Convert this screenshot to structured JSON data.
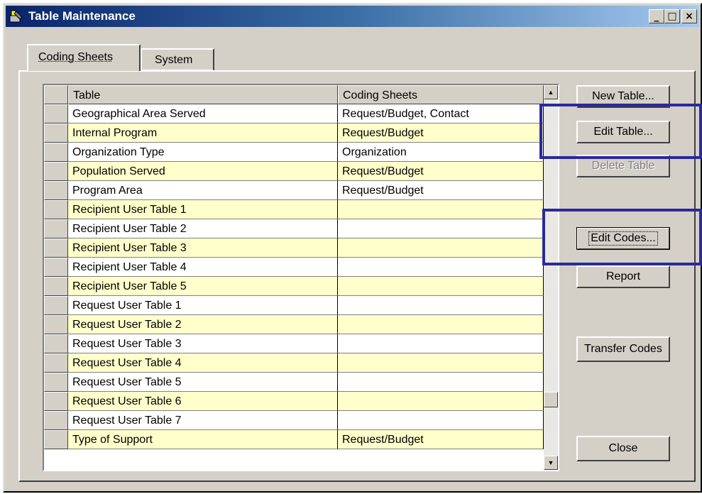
{
  "window": {
    "title": "Table Maintenance",
    "minimize_glyph": "_",
    "maximize_glyph": "□",
    "close_glyph": "×"
  },
  "tabs": [
    {
      "label": "Coding Sheets",
      "selected": true
    },
    {
      "label": "System",
      "selected": false
    }
  ],
  "grid": {
    "columns": [
      "Table",
      "Coding Sheets"
    ],
    "rows": [
      {
        "table": "Geographical Area Served",
        "sheets": "Request/Budget, Contact"
      },
      {
        "table": "Internal Program",
        "sheets": "Request/Budget"
      },
      {
        "table": "Organization Type",
        "sheets": "Organization"
      },
      {
        "table": "Population Served",
        "sheets": "Request/Budget"
      },
      {
        "table": "Program Area",
        "sheets": "Request/Budget"
      },
      {
        "table": "Recipient User Table 1",
        "sheets": ""
      },
      {
        "table": "Recipient User Table 2",
        "sheets": ""
      },
      {
        "table": "Recipient User Table 3",
        "sheets": ""
      },
      {
        "table": "Recipient User Table 4",
        "sheets": ""
      },
      {
        "table": "Recipient User Table 5",
        "sheets": ""
      },
      {
        "table": "Request User Table 1",
        "sheets": ""
      },
      {
        "table": "Request User Table 2",
        "sheets": ""
      },
      {
        "table": "Request User Table 3",
        "sheets": ""
      },
      {
        "table": "Request User Table 4",
        "sheets": ""
      },
      {
        "table": "Request User Table 5",
        "sheets": ""
      },
      {
        "table": "Request User Table 6",
        "sheets": ""
      },
      {
        "table": "Request User Table 7",
        "sheets": ""
      },
      {
        "table": "Type of Support",
        "sheets": "Request/Budget"
      }
    ],
    "row_colors": {
      "odd": "#ffffff",
      "even": "#ffffcc"
    }
  },
  "buttons": {
    "new_table": "New Table...",
    "edit_table": "Edit Table...",
    "delete_table": "Delete Table",
    "edit_codes": "Edit Codes...",
    "report": "Report",
    "transfer_codes": "Transfer Codes",
    "close": "Close"
  },
  "colors": {
    "highlight_border": "#2a2a9a",
    "titlebar": "#0a246a"
  }
}
